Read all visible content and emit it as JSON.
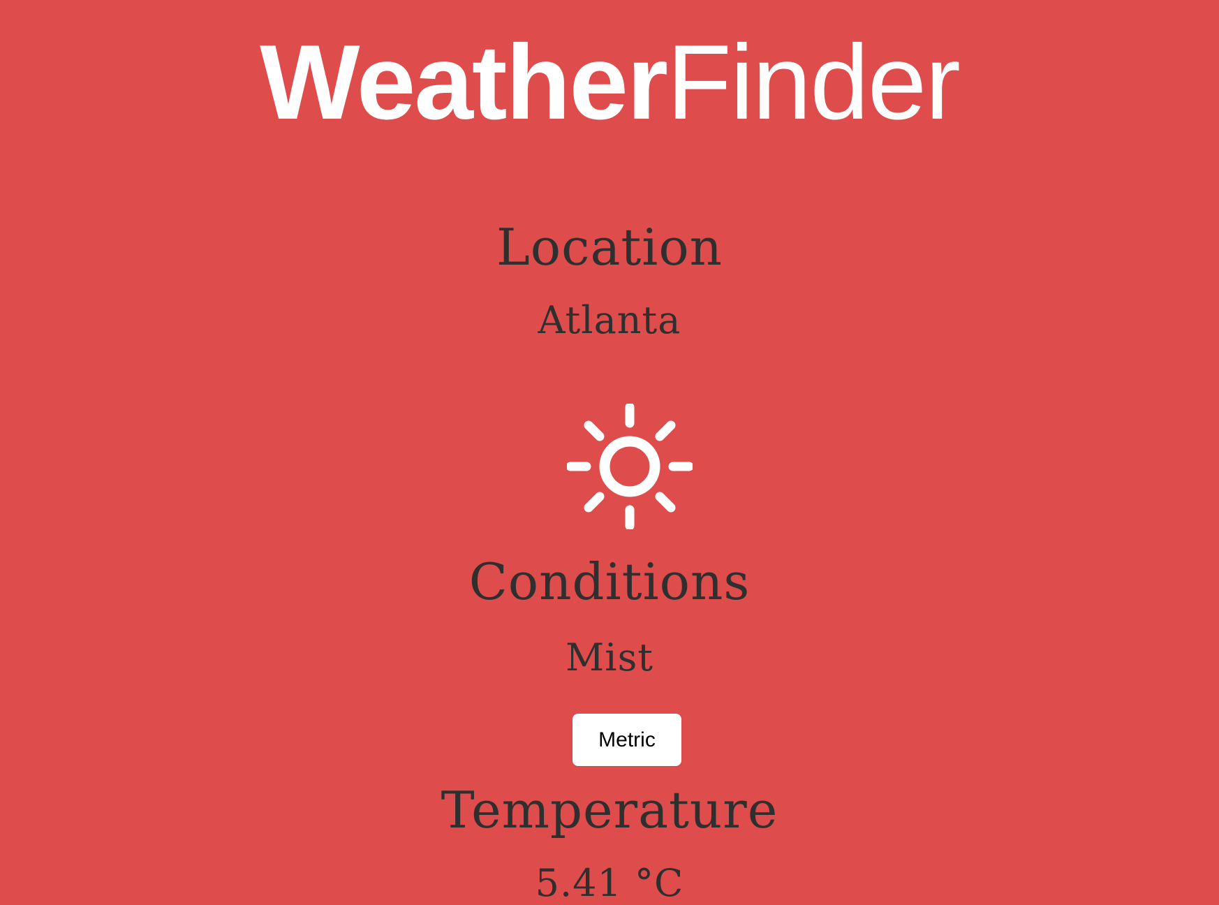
{
  "app": {
    "title_bold": "Weather",
    "title_light": "Finder"
  },
  "location": {
    "label": "Location",
    "value": "Atlanta"
  },
  "weather": {
    "icon": "sun-icon"
  },
  "conditions": {
    "label": "Conditions",
    "value": "Mist"
  },
  "units": {
    "button_label": "Metric"
  },
  "temperature": {
    "label": "Temperature",
    "value": "5.41 °C"
  },
  "colors": {
    "background": "#df4c4c",
    "title": "#ffffff",
    "text": "#2f2f2f",
    "button_background": "#ffffff",
    "button_text": "#000000"
  }
}
